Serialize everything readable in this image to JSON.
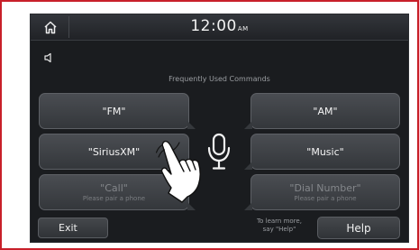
{
  "status": {
    "time": "12:00",
    "ampm": "AM"
  },
  "commands_title": "Frequently Used Commands",
  "commands": [
    {
      "label": "\"FM\"",
      "sub": ""
    },
    {
      "label": "\"AM\"",
      "sub": ""
    },
    {
      "label": "\"SiriusXM\"",
      "sub": ""
    },
    {
      "label": "\"Music\"",
      "sub": ""
    },
    {
      "label": "\"Call\"",
      "sub": "Please pair a phone"
    },
    {
      "label": "\"Dial Number\"",
      "sub": "Please pair a phone"
    }
  ],
  "footer": {
    "exit_label": "Exit",
    "hint_line1": "To learn more,",
    "hint_line2": "say \"Help\"",
    "help_label": "Help"
  },
  "icons": {
    "home": "home-icon",
    "volume": "speaker-icon",
    "mic": "microphone-icon",
    "hand": "touch-hand-icon"
  },
  "colors": {
    "frame_border": "#c8202a",
    "screen_bg": "#1a1c1f",
    "button_bg": "#404348",
    "text": "#f4f4f4",
    "muted_text": "#84878b"
  }
}
